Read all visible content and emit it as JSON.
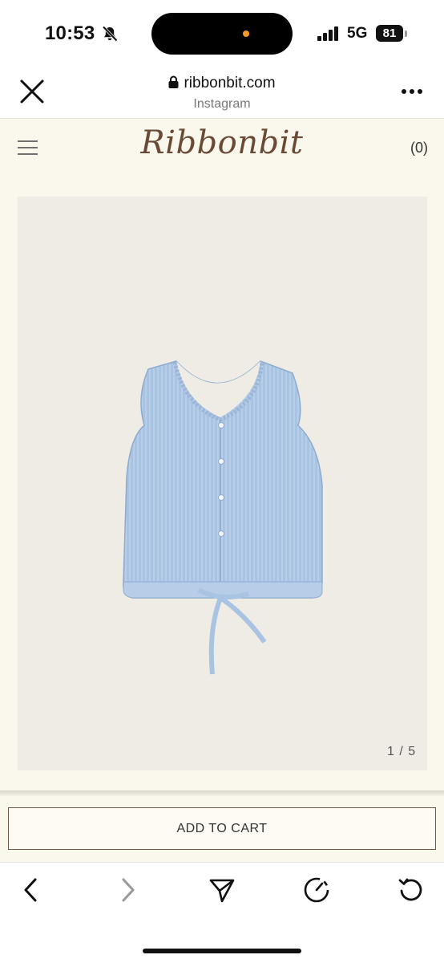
{
  "status_bar": {
    "time": "10:53",
    "network": "5G",
    "battery": "81",
    "icons": [
      "bell-off-icon",
      "signal-bars-icon",
      "battery-icon"
    ],
    "island_dot_color": "#f29a2e"
  },
  "browser": {
    "url": "ribbonbit.com",
    "subtitle": "Instagram",
    "icons": [
      "close-icon",
      "lock-icon",
      "more-icon"
    ]
  },
  "site": {
    "logo": "Ribbonbit",
    "cart_count": "(0)",
    "menu_icon": "hamburger-icon",
    "background": "#faf7ed"
  },
  "product": {
    "image_description_icon": "sleeveless-blouse-image",
    "pager": "1 / 5",
    "add_to_cart": "ADD TO CART",
    "frame_background": "#eeece4"
  },
  "toolbar": {
    "icons": [
      "back-icon",
      "forward-icon",
      "share-icon",
      "speed-icon",
      "reload-icon"
    ]
  }
}
